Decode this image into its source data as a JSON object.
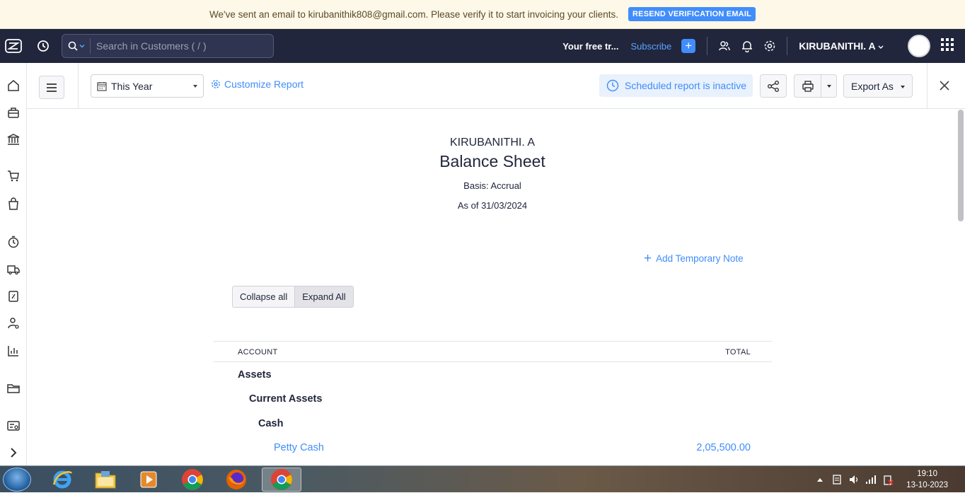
{
  "banner": {
    "message": "We've sent an email to kirubanithik808@gmail.com. Please verify it to start invoicing your clients.",
    "resend_label": "RESEND VERIFICATION EMAIL"
  },
  "topnav": {
    "search_placeholder": "Search in Customers ( / )",
    "trial_text": "Your free tr...",
    "subscribe_label": "Subscribe",
    "org_name": "KIRUBANITHI. A"
  },
  "toolbar": {
    "period": "This Year",
    "customize_label": "Customize Report",
    "scheduled_label": "Scheduled report is inactive",
    "export_label": "Export As"
  },
  "report": {
    "org": "KIRUBANITHI. A",
    "title": "Balance Sheet",
    "basis": "Basis: Accrual",
    "as_of": "As of 31/03/2024",
    "add_note_label": "Add Temporary Note",
    "collapse_label": "Collapse all",
    "expand_label": "Expand All",
    "col_account": "ACCOUNT",
    "col_total": "TOTAL",
    "rows": [
      {
        "label": "Assets"
      },
      {
        "label": "Current Assets"
      },
      {
        "label": "Cash"
      },
      {
        "label": "Petty Cash",
        "total": "2,05,500.00"
      }
    ]
  },
  "taskbar": {
    "time": "19:10",
    "date": "13-10-2023"
  },
  "colors": {
    "accent": "#408dfb",
    "nav_bg": "#21263c",
    "banner_bg": "#fdf8e7"
  }
}
